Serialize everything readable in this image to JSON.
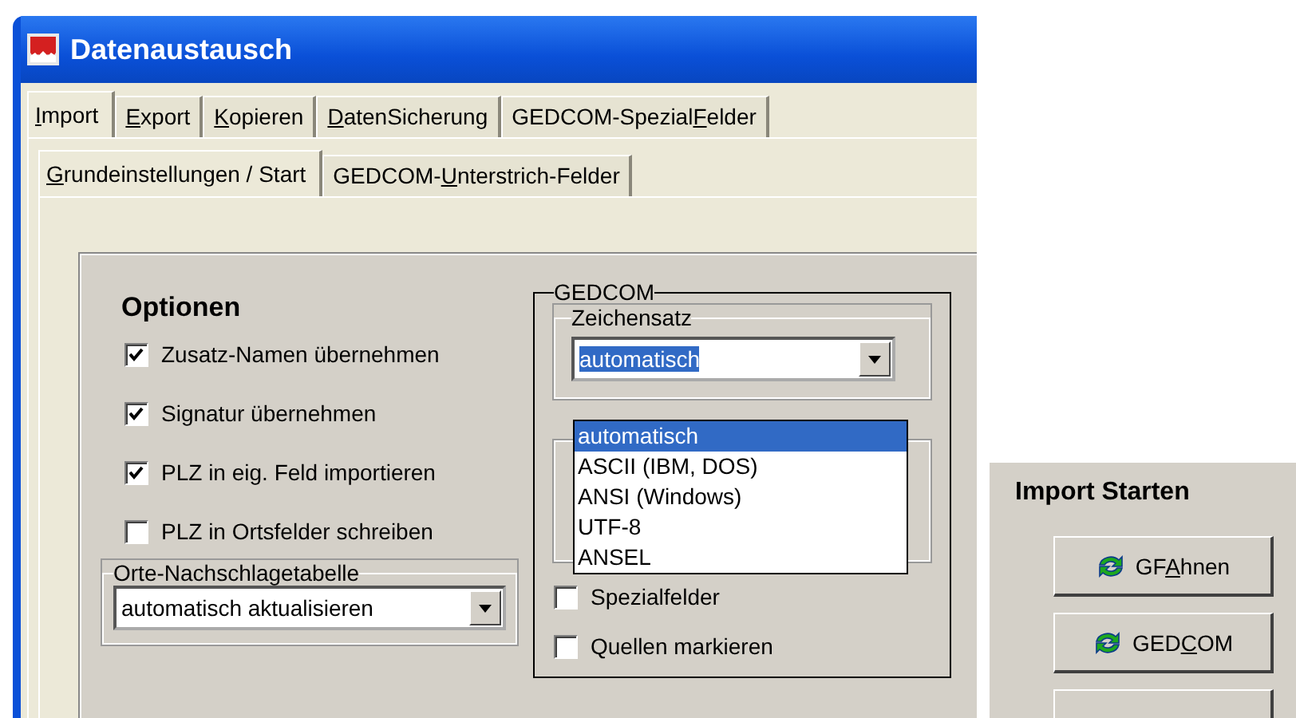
{
  "window": {
    "title": "Datenaustausch"
  },
  "tabs": [
    {
      "key": "I",
      "end": "mport",
      "selected": true
    },
    {
      "key": "E",
      "end": "xport",
      "selected": false
    },
    {
      "key": "K",
      "end": "opieren",
      "selected": false
    },
    {
      "key": "D",
      "end": "atenSicherung",
      "selected": false
    },
    {
      "start": "GEDCOM-Spezial",
      "key": "F",
      "end": "elder",
      "selected": false
    }
  ],
  "subtabs": [
    {
      "key": "G",
      "end": "rundeinstellungen / Start",
      "selected": true
    },
    {
      "start": "GEDCOM-",
      "key": "U",
      "end": "nterstrich-Felder",
      "selected": false
    }
  ],
  "options": {
    "title": "Optionen",
    "checkboxes": [
      {
        "label": "Zusatz-Namen übernehmen",
        "checked": true
      },
      {
        "label": "Signatur übernehmen",
        "checked": true
      },
      {
        "label": "PLZ in eig. Feld importieren",
        "checked": true
      },
      {
        "label": "PLZ in Ortsfelder schreiben",
        "checked": false
      }
    ],
    "lookup": {
      "title": "Orte-Nachschlagetabelle",
      "value": "automatisch aktualisieren"
    }
  },
  "gedcom": {
    "title": "GEDCOM",
    "charset": {
      "title": "Zeichensatz",
      "value": "automatisch",
      "options": [
        {
          "label": "automatisch",
          "selected": true
        },
        {
          "label": "ASCII (IBM, DOS)",
          "selected": false
        },
        {
          "label": "ANSI (Windows)",
          "selected": false
        },
        {
          "label": "UTF-8",
          "selected": false
        },
        {
          "label": "ANSEL",
          "selected": false
        }
      ]
    },
    "checkboxes": [
      {
        "label": "Spezialfelder",
        "checked": false
      },
      {
        "label": "Quellen markieren",
        "checked": false
      }
    ]
  },
  "import_start": {
    "title": "Import Starten",
    "buttons": [
      {
        "kind": "full",
        "start": "GF",
        "key": "A",
        "end": "hnen"
      },
      {
        "kind": "full",
        "start": "GED",
        "key": "C",
        "end": "OM"
      },
      {
        "kind": "cut"
      }
    ]
  }
}
